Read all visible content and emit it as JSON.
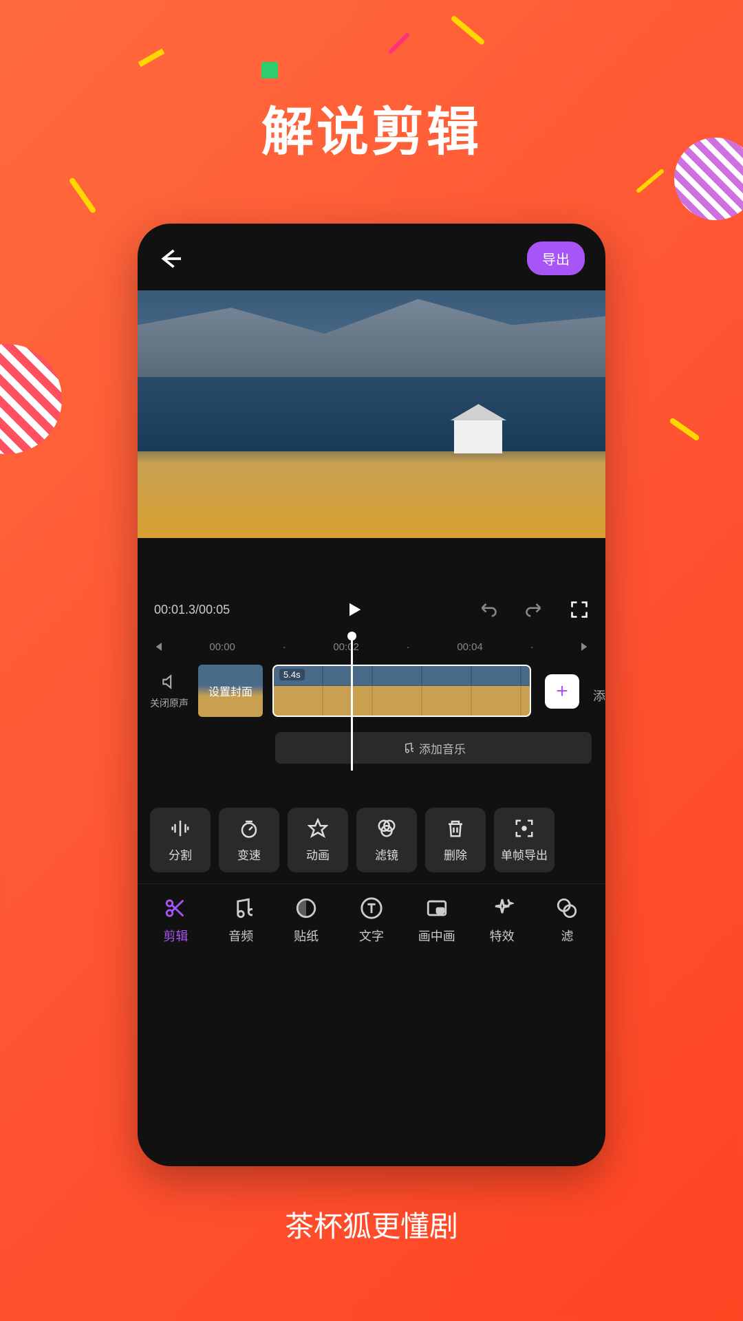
{
  "hero": {
    "title": "解说剪辑",
    "tagline": "茶杯狐更懂剧"
  },
  "editor": {
    "export_label": "导出",
    "playback": {
      "time": "00:01.3/00:05"
    },
    "ruler": {
      "marks": [
        "00:00",
        "00:02",
        "00:04"
      ]
    },
    "timeline": {
      "mute_label": "关闭原声",
      "cover_label": "设置封面",
      "clip_duration": "5.4s",
      "add_label": "添"
    },
    "music": {
      "add_label": "添加音乐"
    },
    "tools": [
      {
        "id": "split",
        "label": "分割",
        "icon": "split"
      },
      {
        "id": "speed",
        "label": "变速",
        "icon": "speed"
      },
      {
        "id": "anim",
        "label": "动画",
        "icon": "star"
      },
      {
        "id": "filter",
        "label": "滤镜",
        "icon": "venn"
      },
      {
        "id": "delete",
        "label": "删除",
        "icon": "trash"
      },
      {
        "id": "frame",
        "label": "单帧导出",
        "icon": "focus"
      }
    ],
    "tabs": [
      {
        "id": "edit",
        "label": "剪辑",
        "icon": "scissors",
        "active": true
      },
      {
        "id": "audio",
        "label": "音频",
        "icon": "music"
      },
      {
        "id": "sticker",
        "label": "贴纸",
        "icon": "circle"
      },
      {
        "id": "text",
        "label": "文字",
        "icon": "text"
      },
      {
        "id": "pip",
        "label": "画中画",
        "icon": "pip"
      },
      {
        "id": "fx",
        "label": "特效",
        "icon": "sparkle"
      },
      {
        "id": "filter2",
        "label": "滤",
        "icon": "dots"
      }
    ]
  }
}
